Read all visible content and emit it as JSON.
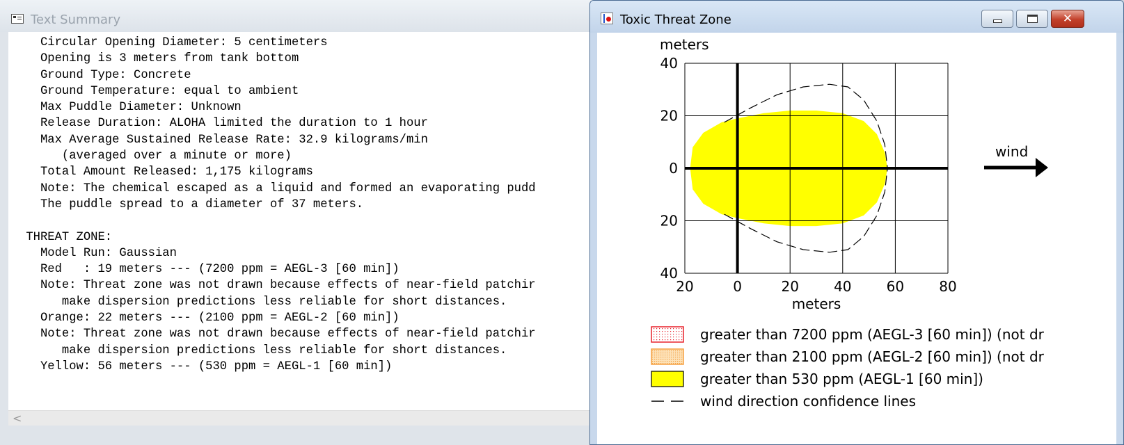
{
  "text_summary": {
    "title": "Text Summary",
    "lines": [
      "   Circular Opening Diameter: 5 centimeters",
      "   Opening is 3 meters from tank bottom",
      "   Ground Type: Concrete",
      "   Ground Temperature: equal to ambient",
      "   Max Puddle Diameter: Unknown",
      "   Release Duration: ALOHA limited the duration to 1 hour",
      "   Max Average Sustained Release Rate: 32.9 kilograms/min",
      "      (averaged over a minute or more)",
      "   Total Amount Released: 1,175 kilograms",
      "   Note: The chemical escaped as a liquid and formed an evaporating pudd",
      "   The puddle spread to a diameter of 37 meters.",
      "",
      " THREAT ZONE:",
      "   Model Run: Gaussian",
      "   Red   : 19 meters --- (7200 ppm = AEGL-3 [60 min])",
      "   Note: Threat zone was not drawn because effects of near-field patchir",
      "      make dispersion predictions less reliable for short distances.",
      "   Orange: 22 meters --- (2100 ppm = AEGL-2 [60 min])",
      "   Note: Threat zone was not drawn because effects of near-field patchir",
      "      make dispersion predictions less reliable for short distances.",
      "   Yellow: 56 meters --- (530 ppm = AEGL-1 [60 min])"
    ],
    "scroll_left_glyph": "<"
  },
  "threat_zone": {
    "title": "Toxic Threat Zone",
    "close_glyph": "✕"
  },
  "chart_data": {
    "type": "area",
    "ylabel": "meters",
    "xlabel": "meters",
    "xlim": [
      -20,
      80
    ],
    "ylim": [
      -40,
      40
    ],
    "x_ticks": [
      -20,
      0,
      20,
      40,
      60,
      80
    ],
    "x_tick_labels": [
      "20",
      "0",
      "20",
      "40",
      "60",
      "80"
    ],
    "y_ticks": [
      40,
      20,
      0,
      -20,
      -40
    ],
    "y_tick_labels": [
      "40",
      "20",
      "0",
      "20",
      "40"
    ],
    "grid": true,
    "wind_label": "wind",
    "yellow_zone_outline": [
      [
        -18,
        0
      ],
      [
        -17,
        8
      ],
      [
        -13,
        13.5
      ],
      [
        -6,
        17.5
      ],
      [
        0,
        19
      ],
      [
        10,
        21
      ],
      [
        20,
        22
      ],
      [
        30,
        22
      ],
      [
        40,
        21
      ],
      [
        48,
        18
      ],
      [
        53,
        13
      ],
      [
        56,
        6
      ],
      [
        57,
        0
      ],
      [
        56,
        -6
      ],
      [
        53,
        -13
      ],
      [
        48,
        -18
      ],
      [
        40,
        -21
      ],
      [
        30,
        -22
      ],
      [
        20,
        -22
      ],
      [
        10,
        -21
      ],
      [
        0,
        -19
      ],
      [
        -6,
        -17.5
      ],
      [
        -13,
        -13.5
      ],
      [
        -17,
        -8
      ]
    ],
    "confidence_line_upper": [
      [
        -5,
        17.5
      ],
      [
        5,
        23
      ],
      [
        15,
        28
      ],
      [
        25,
        31
      ],
      [
        35,
        32
      ],
      [
        42,
        31
      ],
      [
        48,
        26
      ],
      [
        53,
        18
      ],
      [
        56,
        9
      ],
      [
        57,
        0
      ]
    ],
    "confidence_line_lower": [
      [
        -5,
        -17.5
      ],
      [
        5,
        -23
      ],
      [
        15,
        -28
      ],
      [
        25,
        -31
      ],
      [
        35,
        -32
      ],
      [
        42,
        -31
      ],
      [
        48,
        -26
      ],
      [
        53,
        -18
      ],
      [
        56,
        -9
      ],
      [
        57,
        0
      ]
    ],
    "legend": [
      {
        "label": "greater than 7200 ppm (AEGL-3 [60 min]) (not dr",
        "swatch": "red-dotted",
        "color": "#e8202a"
      },
      {
        "label": "greater than 2100 ppm (AEGL-2 [60 min]) (not dr",
        "swatch": "orange-dotted",
        "color": "#f5a040"
      },
      {
        "label": "greater than 530 ppm (AEGL-1 [60 min])",
        "swatch": "yellow-solid",
        "color": "#ffff00"
      },
      {
        "label": "wind direction confidence lines",
        "swatch": "dashed-line",
        "color": "#000000"
      }
    ]
  }
}
